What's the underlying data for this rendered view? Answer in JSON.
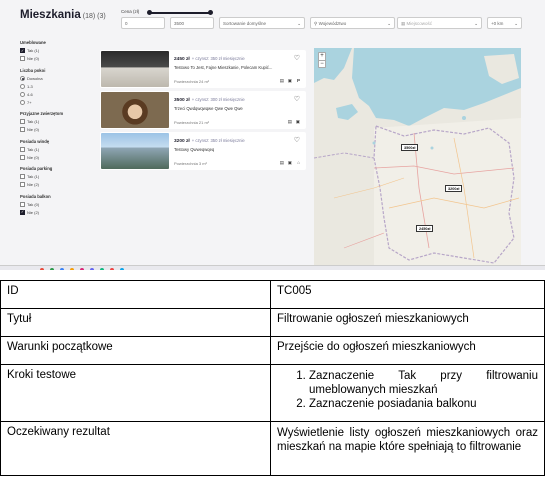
{
  "app": {
    "title": "Mieszkania",
    "count": "(18) (3)",
    "price_label": "Cena (zł)",
    "price_min": "0",
    "price_max": "3500",
    "sort": "Sortowanie domyślne",
    "voivodeship_placeholder": "Województwo",
    "city_placeholder": "Miejscowość",
    "radius": "+0 km",
    "filters": [
      {
        "title": "Umeblowane",
        "type": "checkbox",
        "options": [
          {
            "label": "Tak (1)",
            "checked": true
          },
          {
            "label": "Nie (0)",
            "checked": false
          }
        ]
      },
      {
        "title": "Liczba pokoi",
        "type": "radio",
        "options": [
          {
            "label": "Dowolna",
            "checked": true
          },
          {
            "label": "1-3",
            "checked": false
          },
          {
            "label": "4-6",
            "checked": false
          },
          {
            "label": "7+",
            "checked": false
          }
        ]
      },
      {
        "title": "Przyjazne zwierzętom",
        "type": "checkbox",
        "options": [
          {
            "label": "Tak (1)",
            "checked": false
          },
          {
            "label": "Nie (0)",
            "checked": false
          }
        ]
      },
      {
        "title": "Posiada windę",
        "type": "checkbox",
        "options": [
          {
            "label": "Tak (1)",
            "checked": false
          },
          {
            "label": "Nie (0)",
            "checked": false
          }
        ]
      },
      {
        "title": "Posiada parking",
        "type": "checkbox",
        "options": [
          {
            "label": "Tak (1)",
            "checked": false
          },
          {
            "label": "Nie (2)",
            "checked": false
          }
        ]
      },
      {
        "title": "Posiada balkon",
        "type": "checkbox",
        "options": [
          {
            "label": "Tak (0)",
            "checked": false
          },
          {
            "label": "Nie (2)",
            "checked": true
          }
        ]
      }
    ],
    "listings": [
      {
        "price": "2450 zł",
        "rent": "+ czynsz: 350 zł miesięcznie",
        "title": "Testowo To Jest, Fajne Mieszkanie, Polecam Kupić...",
        "area": "Powierzchnia 24 m²"
      },
      {
        "price": "3500 zł",
        "rent": "+ czynsz: 300 zł miesięcznie",
        "title": "Trzeci Qwdqwqwqwe Qwe Qwe Qwe",
        "area": "Powierzchnia 21 m²"
      },
      {
        "price": "3200 zł",
        "rent": "+ czynsz: 350 zł miesięcznie",
        "title": "Testowy Qwweqwqeq",
        "area": "Powierzchnia 3 m²"
      }
    ],
    "map_pins": [
      "3500zł",
      "3200zł",
      "2450zł"
    ],
    "zoom_in": "+",
    "zoom_out": "−"
  },
  "table": {
    "rows": [
      {
        "key": "ID",
        "value": "TC005"
      },
      {
        "key": "Tytuł",
        "value": "Filtrowanie ogłoszeń mieszkaniowych"
      },
      {
        "key": "Warunki początkowe",
        "value": "Przejście do ogłoszeń mieszkaniowych"
      },
      {
        "key": "Kroki testowe",
        "steps": [
          "Zaznaczenie Tak przy filtrowaniu umeblowanych mieszkań",
          "Zaznaczenie posiadania balkonu"
        ]
      },
      {
        "key": "Oczekiwany rezultat",
        "value": "Wyświetlenie listy ogłoszeń mieszkaniowych oraz mieszkań na mapie które spełniają to filtrowanie"
      }
    ]
  },
  "colors": {
    "accent": "#1d1d2b",
    "map_land": "#eae8e0",
    "map_water": "#aad3df",
    "border": "#000000"
  }
}
